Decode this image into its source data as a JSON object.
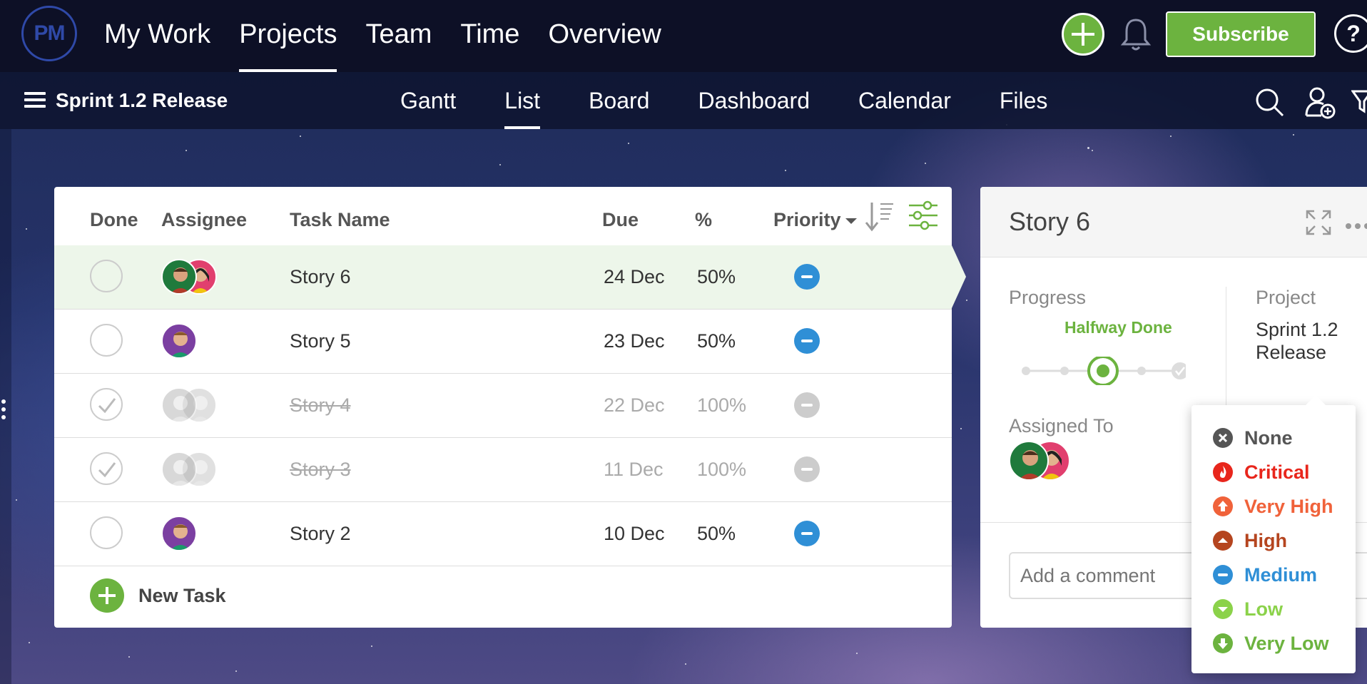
{
  "nav": {
    "logo_text": "PM",
    "items": [
      {
        "label": "My Work",
        "active": false
      },
      {
        "label": "Projects",
        "active": true
      },
      {
        "label": "Team",
        "active": false
      },
      {
        "label": "Time",
        "active": false
      },
      {
        "label": "Overview",
        "active": false
      }
    ],
    "subscribe_label": "Subscribe",
    "help_label": "?"
  },
  "project": {
    "name": "Sprint 1.2 Release",
    "views": [
      {
        "label": "Gantt",
        "active": false
      },
      {
        "label": "List",
        "active": true
      },
      {
        "label": "Board",
        "active": false
      },
      {
        "label": "Dashboard",
        "active": false
      },
      {
        "label": "Calendar",
        "active": false
      },
      {
        "label": "Files",
        "active": false
      }
    ]
  },
  "table": {
    "headers": {
      "done": "Done",
      "assignee": "Assignee",
      "task": "Task Name",
      "due": "Due",
      "pct": "%",
      "priority": "Priority"
    },
    "rows": [
      {
        "name": "Story 6",
        "due": "24 Dec",
        "pct": "50%",
        "done": false,
        "selected": true,
        "priority": "Medium"
      },
      {
        "name": "Story 5",
        "due": "23 Dec",
        "pct": "50%",
        "done": false,
        "selected": false,
        "priority": "Medium"
      },
      {
        "name": "Story 4",
        "due": "22 Dec",
        "pct": "100%",
        "done": true,
        "selected": false,
        "priority": "Medium"
      },
      {
        "name": "Story 3",
        "due": "11 Dec",
        "pct": "100%",
        "done": true,
        "selected": false,
        "priority": "Medium"
      },
      {
        "name": "Story 2",
        "due": "10 Dec",
        "pct": "50%",
        "done": false,
        "selected": false,
        "priority": "Medium"
      }
    ],
    "new_task_label": "New Task"
  },
  "detail": {
    "title": "Story 6",
    "progress_label": "Progress",
    "progress_status": "Halfway Done",
    "progress_value": 0.5,
    "project_label": "Project",
    "project_value": "Sprint 1.2 Release",
    "assigned_label": "Assigned To",
    "comment_placeholder": "Add a comment"
  },
  "priority_menu": {
    "options": [
      {
        "label": "None",
        "color": "#555555",
        "icon": "close-circle-icon"
      },
      {
        "label": "Critical",
        "color": "#e8261c",
        "icon": "flame-icon"
      },
      {
        "label": "Very High",
        "color": "#f0623a",
        "icon": "arrow-up-icon"
      },
      {
        "label": "High",
        "color": "#b5451f",
        "icon": "chevron-up-icon"
      },
      {
        "label": "Medium",
        "color": "#2f8fd6",
        "icon": "minus-icon"
      },
      {
        "label": "Low",
        "color": "#8bd24a",
        "icon": "chevron-down-icon"
      },
      {
        "label": "Very Low",
        "color": "#6cb33f",
        "icon": "arrow-down-icon"
      }
    ]
  },
  "colors": {
    "accent": "#6cb33f",
    "nav_bg": "#0d1026",
    "medium_priority": "#2f8fd6"
  }
}
